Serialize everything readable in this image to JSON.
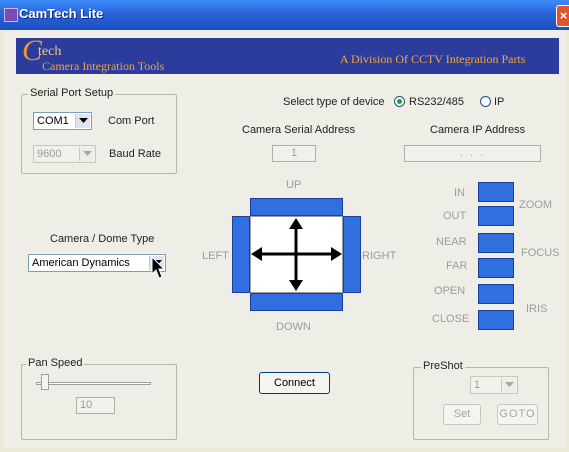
{
  "window": {
    "title": "CamTech Lite",
    "close_glyph": "×"
  },
  "banner": {
    "logo_c": "C",
    "logo_tech": "tech",
    "logo_sub": "Camera Integration Tools",
    "right_text": "A Division Of CCTV Integration Parts"
  },
  "serial": {
    "group_label": "Serial Port Setup",
    "port_value": "COM1",
    "port_label": "Com Port",
    "baud_value": "9600",
    "baud_label": "Baud Rate"
  },
  "device": {
    "prompt": "Select type of device",
    "option_rs": "RS232/485",
    "option_ip": "IP",
    "selected": "RS232/485",
    "serial_address_label": "Camera Serial Address",
    "serial_address_value": "1",
    "ip_address_label": "Camera IP Address",
    "ip_address_value": ".   .   ."
  },
  "camera_type": {
    "label": "Camera / Dome Type",
    "value": "American Dynamics"
  },
  "ptz": {
    "up": "UP",
    "down": "DOWN",
    "left": "LEFT",
    "right": "RIGHT"
  },
  "lens": {
    "in": "IN",
    "out": "OUT",
    "zoom": "ZOOM",
    "near": "NEAR",
    "far": "FAR",
    "focus": "FOCUS",
    "open": "OPEN",
    "close": "CLOSE",
    "iris": "IRIS"
  },
  "pan_speed": {
    "group_label": "Pan Speed",
    "value": "10",
    "level": 0.05
  },
  "connect": {
    "label": "Connect"
  },
  "preshot": {
    "group_label": "PreShot",
    "value": "1",
    "set_label": "Set",
    "goto_label": "GOTO"
  },
  "colors": {
    "accent_blue": "#2f6fe0",
    "banner_blue": "#2b3c9c",
    "banner_text": "#f4a53a"
  }
}
